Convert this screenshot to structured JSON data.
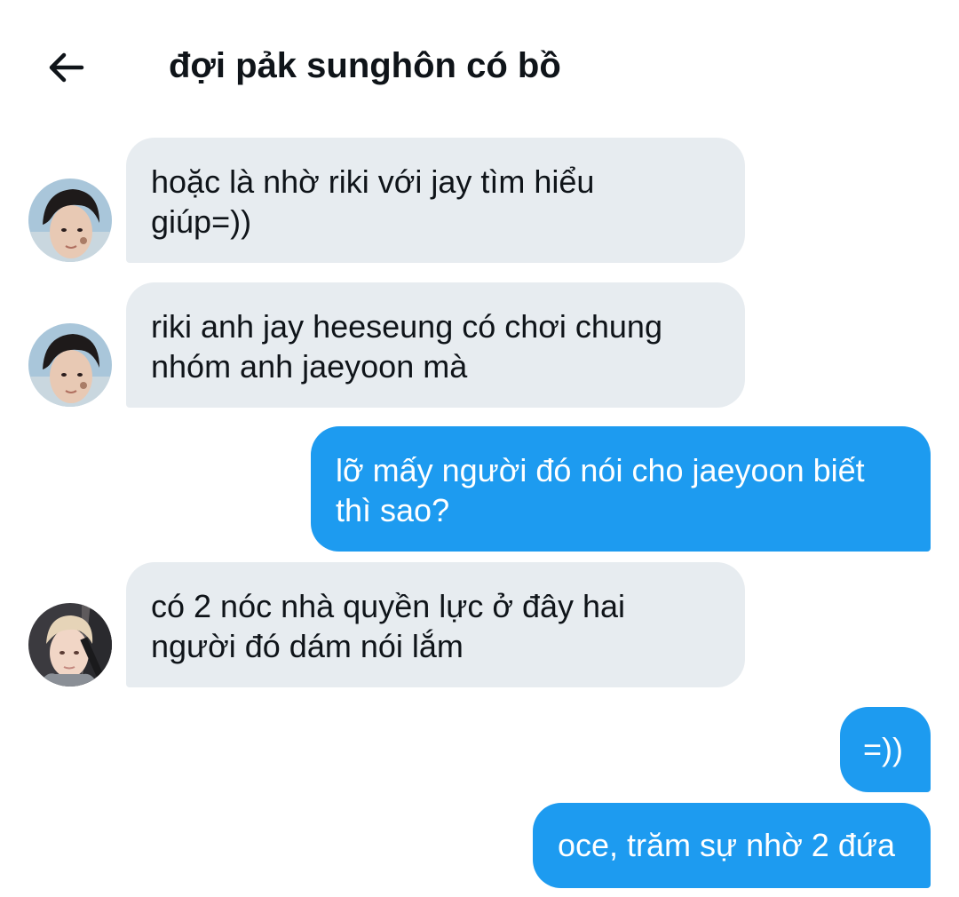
{
  "header": {
    "back_icon": "arrow-left-icon",
    "title": "đợi pảk sunghôn có bồ"
  },
  "colors": {
    "incoming_bubble": "#e7ecf0",
    "outgoing_bubble": "#1d9bf0",
    "text": "#0f1419"
  },
  "messages": [
    {
      "direction": "incoming",
      "avatar": "avatar-photo-1",
      "text": "hoặc là nhờ riki với jay tìm hiểu\ngiúp=))"
    },
    {
      "direction": "incoming",
      "avatar": "avatar-photo-1",
      "text": "riki anh jay heeseung có chơi chung\nnhóm anh jaeyoon mà"
    },
    {
      "direction": "outgoing",
      "text": "lỡ mấy người đó nói cho jaeyoon biết\nthì sao?"
    },
    {
      "direction": "incoming",
      "avatar": "avatar-photo-2",
      "text": "có 2 nóc nhà quyền lực ở đây hai\nngười đó dám nói lắm"
    },
    {
      "direction": "outgoing",
      "text": "=))"
    },
    {
      "direction": "outgoing",
      "text": "oce, trăm sự nhờ 2 đứa"
    }
  ]
}
